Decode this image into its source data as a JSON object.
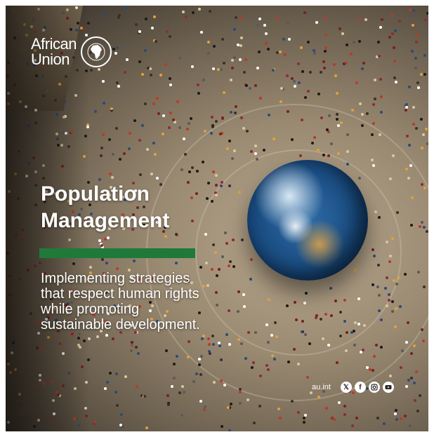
{
  "brand": {
    "name_line1": "African",
    "name_line2": "Union",
    "emblem_icon": "africa-continent-icon"
  },
  "headline": {
    "line1": "Population",
    "line2": "Management"
  },
  "tagline": {
    "line1": "Implementing strategies",
    "line2": "that respect human rights",
    "line3": "while promoting",
    "line4": "sustainable development."
  },
  "footer": {
    "website": "au.int",
    "social_icons": [
      "x-icon",
      "facebook-icon",
      "instagram-icon",
      "youtube-icon"
    ]
  },
  "colors": {
    "accent_green": "#1f7a3a",
    "text": "#ffffff"
  }
}
